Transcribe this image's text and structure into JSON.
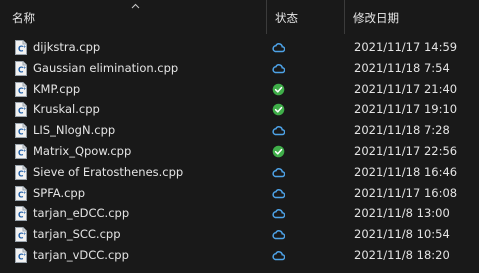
{
  "header": {
    "name_label": "名称",
    "status_label": "状态",
    "date_label": "修改日期"
  },
  "icons": {
    "file": "cpp-file-icon",
    "cloud": "cloud-icon",
    "synced": "green-check-icon"
  },
  "colors": {
    "background": "#191919",
    "cloud": "#4ea3e8",
    "synced": "#3fae49"
  },
  "files": [
    {
      "name": "dijkstra.cpp",
      "date": "2021/11/17 14:59",
      "status": "cloud"
    },
    {
      "name": "Gaussian elimination.cpp",
      "date": "2021/11/18 7:54",
      "status": "cloud"
    },
    {
      "name": "KMP.cpp",
      "date": "2021/11/17 21:40",
      "status": "synced"
    },
    {
      "name": "Kruskal.cpp",
      "date": "2021/11/17 19:10",
      "status": "synced"
    },
    {
      "name": "LIS_NlogN.cpp",
      "date": "2021/11/18 7:28",
      "status": "cloud"
    },
    {
      "name": "Matrix_Qpow.cpp",
      "date": "2021/11/17 22:56",
      "status": "synced"
    },
    {
      "name": "Sieve of Eratosthenes.cpp",
      "date": "2021/11/18 16:46",
      "status": "cloud"
    },
    {
      "name": "SPFA.cpp",
      "date": "2021/11/17 16:08",
      "status": "cloud"
    },
    {
      "name": "tarjan_eDCC.cpp",
      "date": "2021/11/8 13:00",
      "status": "cloud"
    },
    {
      "name": "tarjan_SCC.cpp",
      "date": "2021/11/8 10:54",
      "status": "cloud"
    },
    {
      "name": "tarjan_vDCC.cpp",
      "date": "2021/11/8 18:20",
      "status": "cloud"
    }
  ]
}
